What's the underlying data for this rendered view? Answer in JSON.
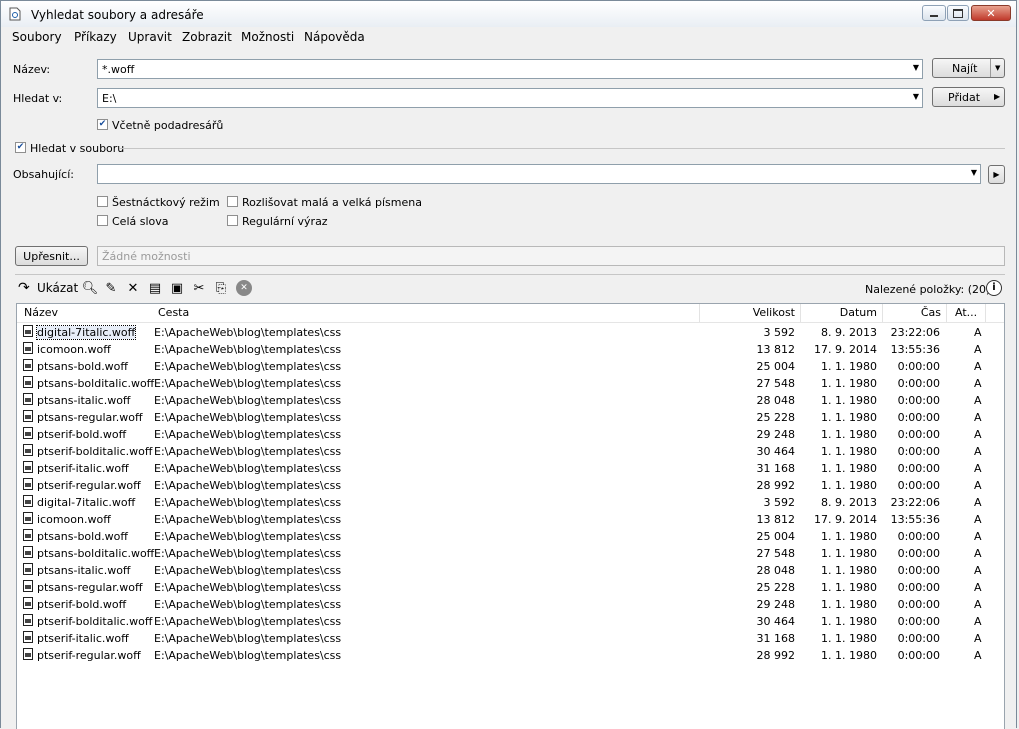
{
  "window": {
    "title": "Vyhledat soubory a adresáře"
  },
  "menu": [
    "Soubory",
    "Příkazy",
    "Upravit",
    "Zobrazit",
    "Možnosti",
    "Nápověda"
  ],
  "search": {
    "name_label": "Název:",
    "name_value": "*.woff",
    "find_button": "Najít",
    "lookin_label": "Hledat v:",
    "lookin_value": "E:\\",
    "add_button": "Přidat",
    "subfolders_label": "Včetně podadresářů",
    "subfolders_checked": true,
    "infile_label": "Hledat v souboru",
    "infile_checked": true,
    "containing_label": "Obsahující:",
    "containing_value": "",
    "hex_label": "Šestnáctkový režim",
    "case_label": "Rozlišovat malá a velká písmena",
    "whole_label": "Celá slova",
    "regex_label": "Regulární výraz",
    "refine_button": "Upřesnit...",
    "refine_placeholder": "Žádné možnosti"
  },
  "toolbar": {
    "show_label": "Ukázat",
    "found_label": "Nalezené položky: (20)"
  },
  "columns": [
    "Název",
    "Cesta",
    "Velikost",
    "Datum",
    "Čas",
    "At..."
  ],
  "rows": [
    {
      "name": "digital-7italic.woff",
      "path": "E:\\ApacheWeb\\blog\\templates\\css",
      "size": "3 592",
      "date": "8. 9. 2013",
      "time": "23:22:06",
      "attr": "A"
    },
    {
      "name": "icomoon.woff",
      "path": "E:\\ApacheWeb\\blog\\templates\\css",
      "size": "13 812",
      "date": "17. 9. 2014",
      "time": "13:55:36",
      "attr": "A"
    },
    {
      "name": "ptsans-bold.woff",
      "path": "E:\\ApacheWeb\\blog\\templates\\css",
      "size": "25 004",
      "date": "1. 1. 1980",
      "time": "0:00:00",
      "attr": "A"
    },
    {
      "name": "ptsans-bolditalic.woff",
      "path": "E:\\ApacheWeb\\blog\\templates\\css",
      "size": "27 548",
      "date": "1. 1. 1980",
      "time": "0:00:00",
      "attr": "A"
    },
    {
      "name": "ptsans-italic.woff",
      "path": "E:\\ApacheWeb\\blog\\templates\\css",
      "size": "28 048",
      "date": "1. 1. 1980",
      "time": "0:00:00",
      "attr": "A"
    },
    {
      "name": "ptsans-regular.woff",
      "path": "E:\\ApacheWeb\\blog\\templates\\css",
      "size": "25 228",
      "date": "1. 1. 1980",
      "time": "0:00:00",
      "attr": "A"
    },
    {
      "name": "ptserif-bold.woff",
      "path": "E:\\ApacheWeb\\blog\\templates\\css",
      "size": "29 248",
      "date": "1. 1. 1980",
      "time": "0:00:00",
      "attr": "A"
    },
    {
      "name": "ptserif-bolditalic.woff",
      "path": "E:\\ApacheWeb\\blog\\templates\\css",
      "size": "30 464",
      "date": "1. 1. 1980",
      "time": "0:00:00",
      "attr": "A"
    },
    {
      "name": "ptserif-italic.woff",
      "path": "E:\\ApacheWeb\\blog\\templates\\css",
      "size": "31 168",
      "date": "1. 1. 1980",
      "time": "0:00:00",
      "attr": "A"
    },
    {
      "name": "ptserif-regular.woff",
      "path": "E:\\ApacheWeb\\blog\\templates\\css",
      "size": "28 992",
      "date": "1. 1. 1980",
      "time": "0:00:00",
      "attr": "A"
    },
    {
      "name": "digital-7italic.woff",
      "path": "E:\\ApacheWeb\\blog\\templates\\css",
      "size": "3 592",
      "date": "8. 9. 2013",
      "time": "23:22:06",
      "attr": "A"
    },
    {
      "name": "icomoon.woff",
      "path": "E:\\ApacheWeb\\blog\\templates\\css",
      "size": "13 812",
      "date": "17. 9. 2014",
      "time": "13:55:36",
      "attr": "A"
    },
    {
      "name": "ptsans-bold.woff",
      "path": "E:\\ApacheWeb\\blog\\templates\\css",
      "size": "25 004",
      "date": "1. 1. 1980",
      "time": "0:00:00",
      "attr": "A"
    },
    {
      "name": "ptsans-bolditalic.woff",
      "path": "E:\\ApacheWeb\\blog\\templates\\css",
      "size": "27 548",
      "date": "1. 1. 1980",
      "time": "0:00:00",
      "attr": "A"
    },
    {
      "name": "ptsans-italic.woff",
      "path": "E:\\ApacheWeb\\blog\\templates\\css",
      "size": "28 048",
      "date": "1. 1. 1980",
      "time": "0:00:00",
      "attr": "A"
    },
    {
      "name": "ptsans-regular.woff",
      "path": "E:\\ApacheWeb\\blog\\templates\\css",
      "size": "25 228",
      "date": "1. 1. 1980",
      "time": "0:00:00",
      "attr": "A"
    },
    {
      "name": "ptserif-bold.woff",
      "path": "E:\\ApacheWeb\\blog\\templates\\css",
      "size": "29 248",
      "date": "1. 1. 1980",
      "time": "0:00:00",
      "attr": "A"
    },
    {
      "name": "ptserif-bolditalic.woff",
      "path": "E:\\ApacheWeb\\blog\\templates\\css",
      "size": "30 464",
      "date": "1. 1. 1980",
      "time": "0:00:00",
      "attr": "A"
    },
    {
      "name": "ptserif-italic.woff",
      "path": "E:\\ApacheWeb\\blog\\templates\\css",
      "size": "31 168",
      "date": "1. 1. 1980",
      "time": "0:00:00",
      "attr": "A"
    },
    {
      "name": "ptserif-regular.woff",
      "path": "E:\\ApacheWeb\\blog\\templates\\css",
      "size": "28 992",
      "date": "1. 1. 1980",
      "time": "0:00:00",
      "attr": "A"
    }
  ]
}
